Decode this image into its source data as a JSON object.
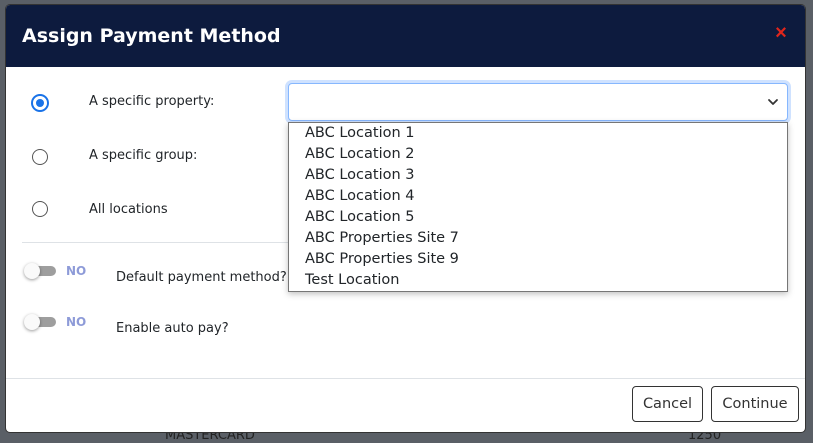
{
  "modal": {
    "title": "Assign Payment Method",
    "close_symbol": "×"
  },
  "options": {
    "specific_property": "A specific property:",
    "specific_group": "A specific group:",
    "all_locations": "All locations"
  },
  "property_select": {
    "value": "",
    "options": [
      "ABC Location 1",
      "ABC Location 2",
      "ABC Location 3",
      "ABC Location 4",
      "ABC Location 5",
      "ABC Properties Site 7",
      "ABC Properties Site 9",
      "Test Location"
    ]
  },
  "toggles": {
    "default_payment": {
      "state": "NO",
      "label": "Default payment method?"
    },
    "auto_pay": {
      "state": "NO",
      "label": "Enable auto pay?"
    }
  },
  "footer": {
    "cancel": "Cancel",
    "continue": "Continue"
  },
  "background": {
    "bottom_left_text": "MASTERCARD",
    "bottom_right_text": "1250"
  },
  "colors": {
    "header_bg": "#0d1b3e",
    "close_icon": "#e0261c",
    "radio_selected": "#1a73e8",
    "toggle_state_text": "#8e9bd8"
  },
  "icons": {
    "close": "close-icon",
    "select_arrow": "chevron-down-icon"
  }
}
